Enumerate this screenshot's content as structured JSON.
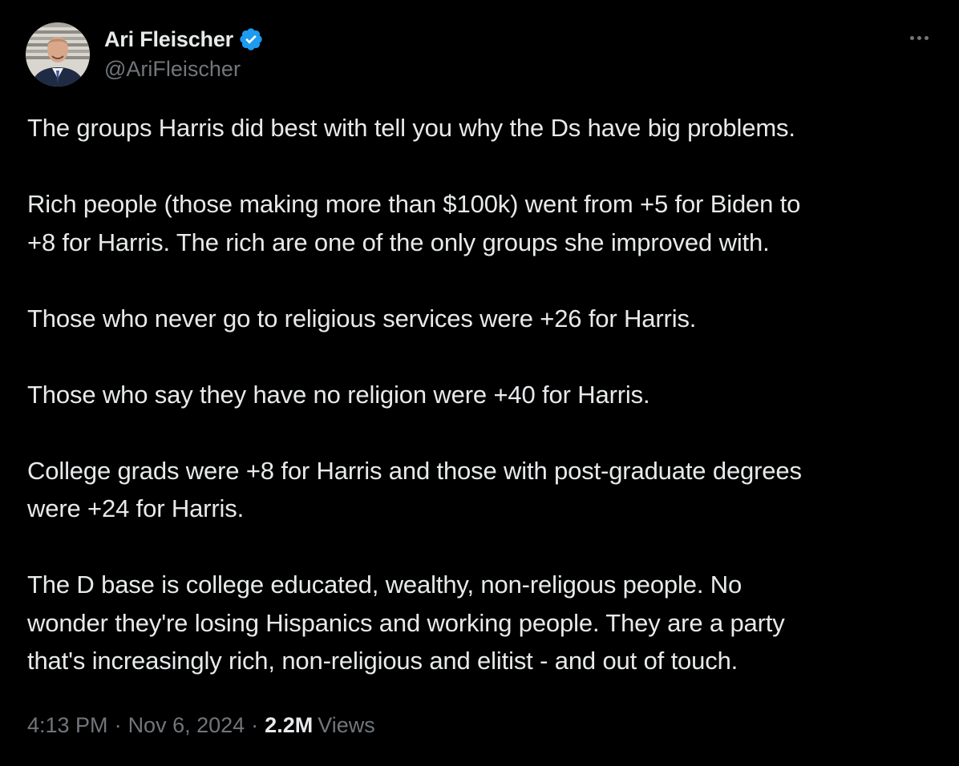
{
  "author": {
    "display_name": "Ari Fleischer",
    "handle": "@AriFleischer",
    "verified": true
  },
  "tweet": {
    "paragraphs": [
      [
        "The groups Harris did best with tell you why the Ds have big problems."
      ],
      [
        "Rich people (those making more than $100k) went from +5 for Biden to",
        "+8 for Harris.  The rich are one of the only groups she improved with."
      ],
      [
        "Those who never go to religious services were +26 for Harris."
      ],
      [
        "Those who say they have no religion were +40 for Harris."
      ],
      [
        "College grads were +8 for Harris and those with post-graduate degrees",
        "were +24 for Harris."
      ],
      [
        "The D base is college educated, wealthy, non-religous people.  No",
        "wonder they're losing Hispanics and working people.  They are a party",
        "that's increasingly rich, non-religious and elitist - and out of touch."
      ]
    ],
    "time": "4:13 PM",
    "separator": "·",
    "date": "Nov 6, 2024",
    "views_count": "2.2M",
    "views_label": "Views"
  },
  "icons": {
    "verified": "verified-badge-icon",
    "more": "more-options-icon"
  },
  "colors": {
    "background": "#000000",
    "text_primary": "#e7e9ea",
    "text_secondary": "#71767b",
    "verified_blue": "#1d9bf0"
  }
}
